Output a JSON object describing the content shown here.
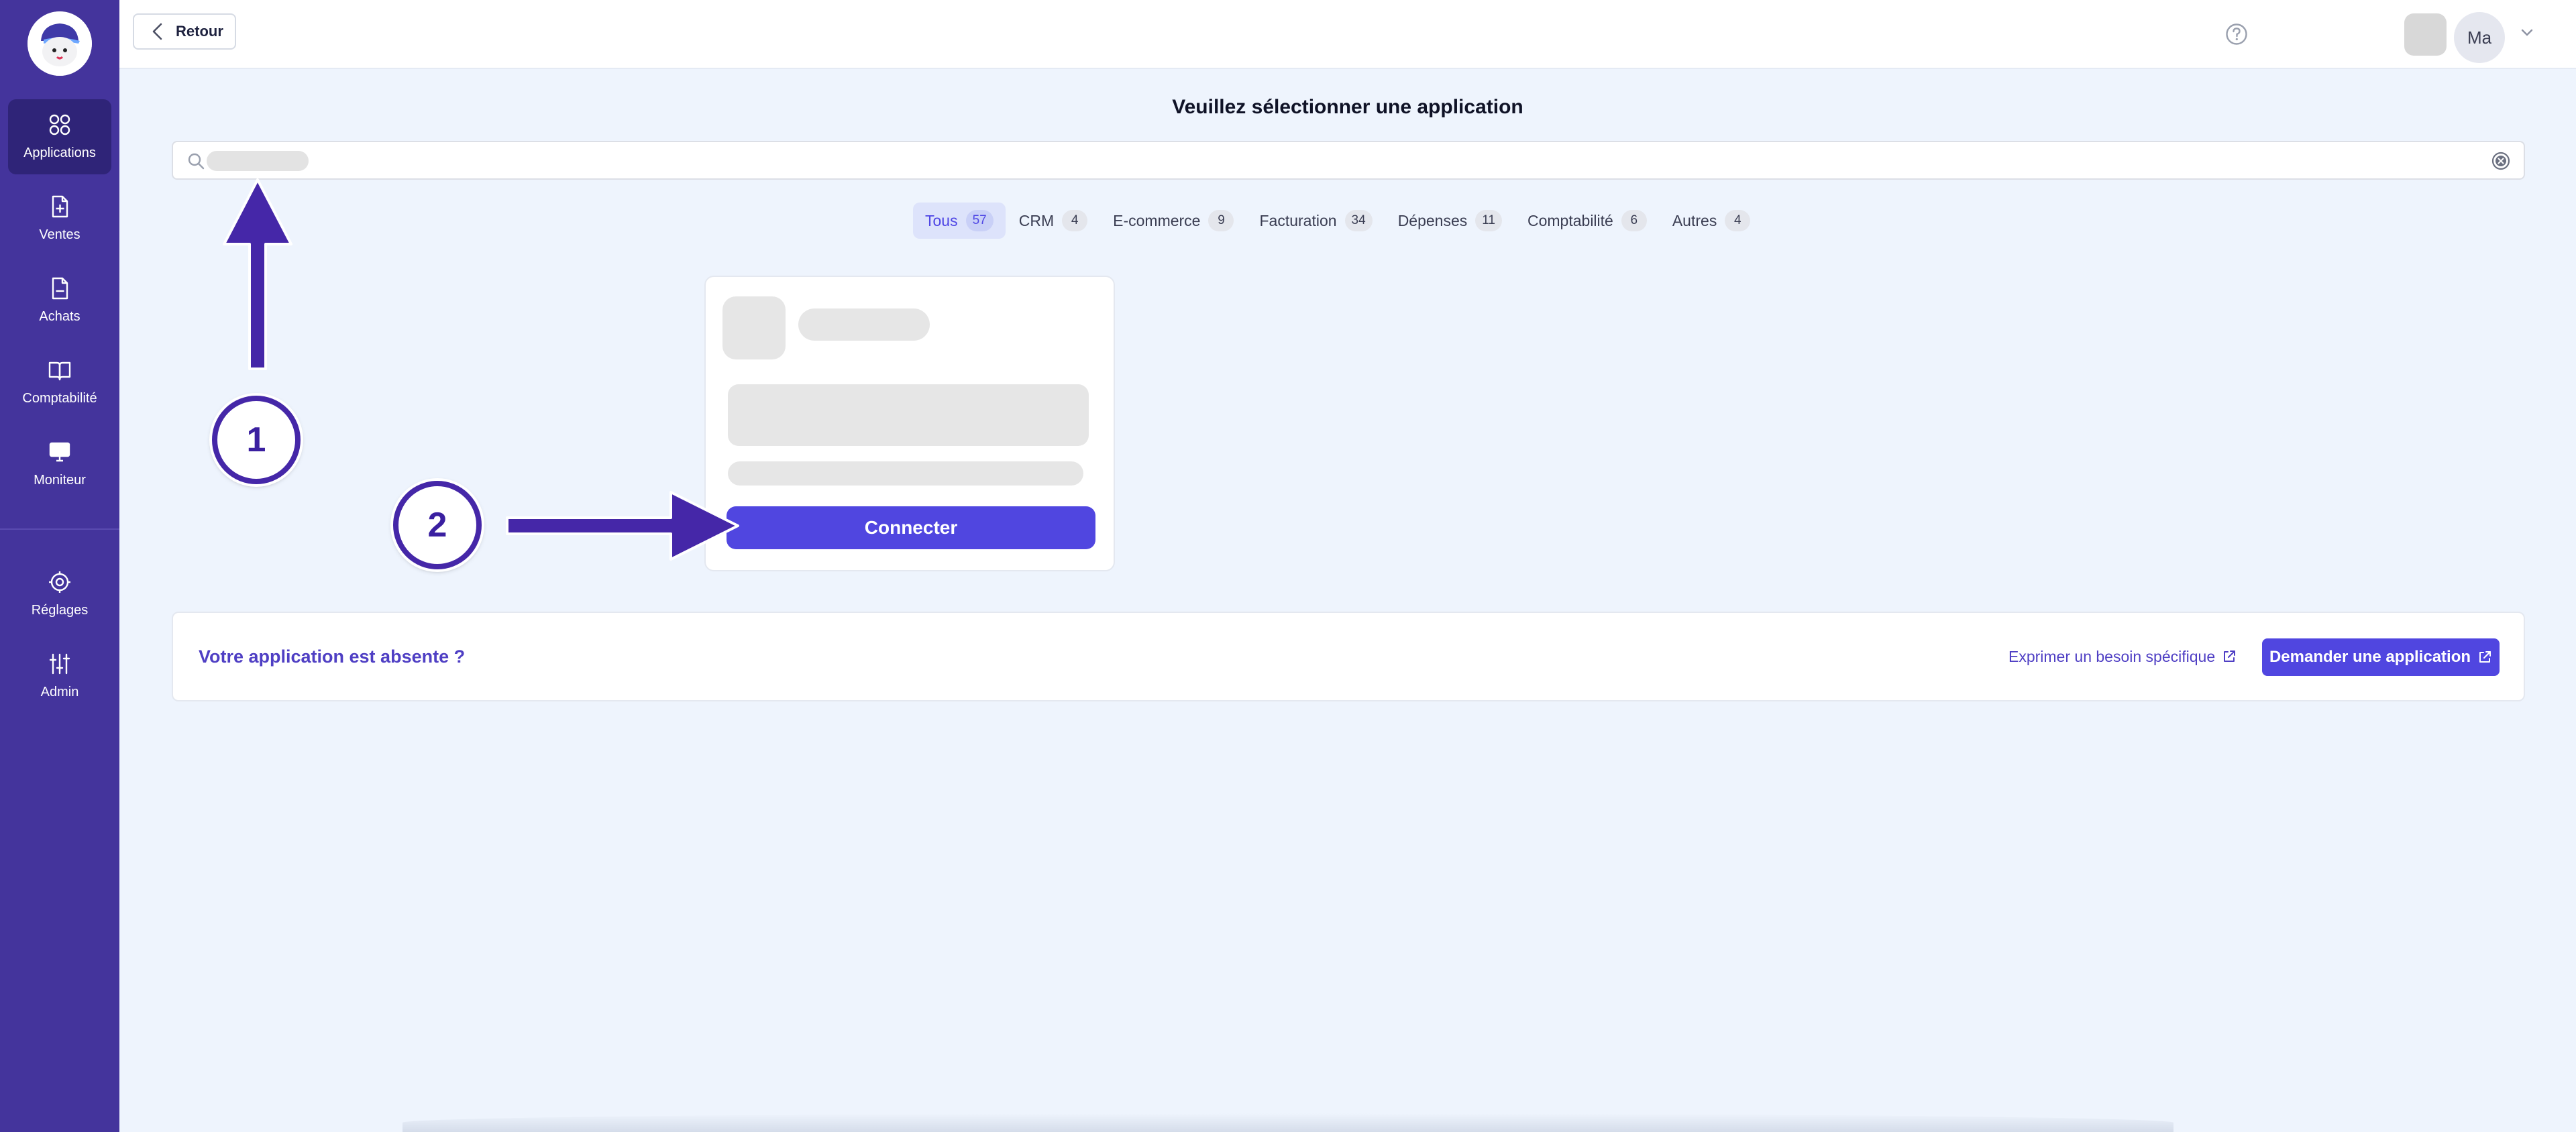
{
  "sidebar": {
    "items": [
      {
        "label": "Applications",
        "icon": "grid-icon"
      },
      {
        "label": "Ventes",
        "icon": "file-plus-icon"
      },
      {
        "label": "Achats",
        "icon": "file-minus-icon"
      },
      {
        "label": "Comptabilité",
        "icon": "book-icon"
      },
      {
        "label": "Moniteur",
        "icon": "monitor-icon"
      },
      {
        "label": "Réglages",
        "icon": "settings-icon"
      },
      {
        "label": "Admin",
        "icon": "sliders-icon"
      }
    ]
  },
  "topbar": {
    "back_label": "Retour",
    "avatar_initials": "Ma"
  },
  "main": {
    "title": "Veuillez sélectionner une application",
    "search": {
      "placeholder": "",
      "value": ""
    },
    "filters": [
      {
        "label": "Tous",
        "count": "57",
        "active": true
      },
      {
        "label": "CRM",
        "count": "4"
      },
      {
        "label": "E-commerce",
        "count": "9"
      },
      {
        "label": "Facturation",
        "count": "34"
      },
      {
        "label": "Dépenses",
        "count": "11"
      },
      {
        "label": "Comptabilité",
        "count": "6"
      },
      {
        "label": "Autres",
        "count": "4"
      }
    ],
    "card": {
      "connect_label": "Connecter"
    },
    "banner": {
      "question": "Votre application est absente ?",
      "need_link": "Exprimer un besoin spécifique",
      "request_button": "Demander une application"
    }
  },
  "annotations": {
    "step1": "1",
    "step2": "2"
  },
  "colors": {
    "sidebar": "#44349c",
    "sidebar_active": "#2f2478",
    "primary": "#5046e0",
    "page_background": "#eef4fd",
    "annotation": "#4527a8"
  }
}
